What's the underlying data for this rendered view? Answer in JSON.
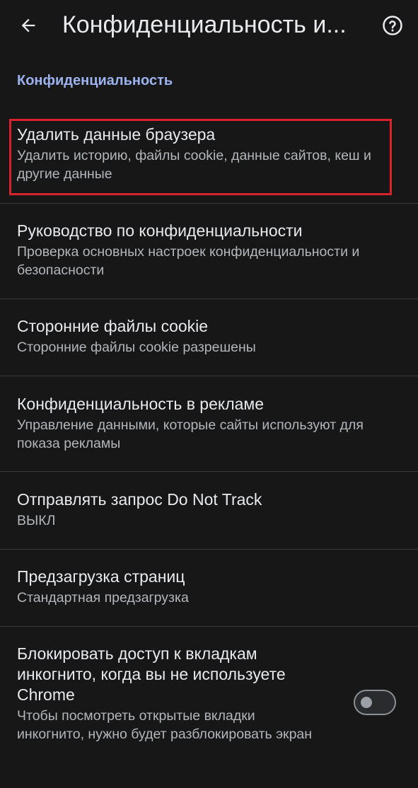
{
  "appbar": {
    "title": "Конфиденциальность и...",
    "back_icon": "arrow-left-icon",
    "help_icon": "help-circle-icon"
  },
  "section": {
    "header": "Конфиденциальность"
  },
  "items": [
    {
      "title": "Удалить данные браузера",
      "subtitle": "Удалить историю, файлы cookie, данные сайтов, кеш и другие данные"
    },
    {
      "title": "Руководство по конфиденциальности",
      "subtitle": "Проверка основных настроек конфиденциальности и безопасности"
    },
    {
      "title": "Сторонние файлы cookie",
      "subtitle": "Сторонние файлы cookie разрешены"
    },
    {
      "title": "Конфиденциальность в рекламе",
      "subtitle": "Управление данными, которые сайты используют для показа рекламы"
    },
    {
      "title": "Отправлять запрос Do Not Track",
      "subtitle": "ВЫКЛ"
    },
    {
      "title": "Предзагрузка страниц",
      "subtitle": "Стандартная предзагрузка"
    },
    {
      "title": "Блокировать доступ к вкладкам инкогнито, когда вы не используете Chrome",
      "subtitle": "Чтобы посмотреть открытые вкладки инкогнито, нужно будет разблокировать экран",
      "toggle_on": false
    }
  ],
  "colors": {
    "background": "#171717",
    "accent": "#9cb3ef",
    "highlight_border": "#d9222b",
    "primary_text": "#e8eaed",
    "secondary_text": "#b3b6ba"
  }
}
